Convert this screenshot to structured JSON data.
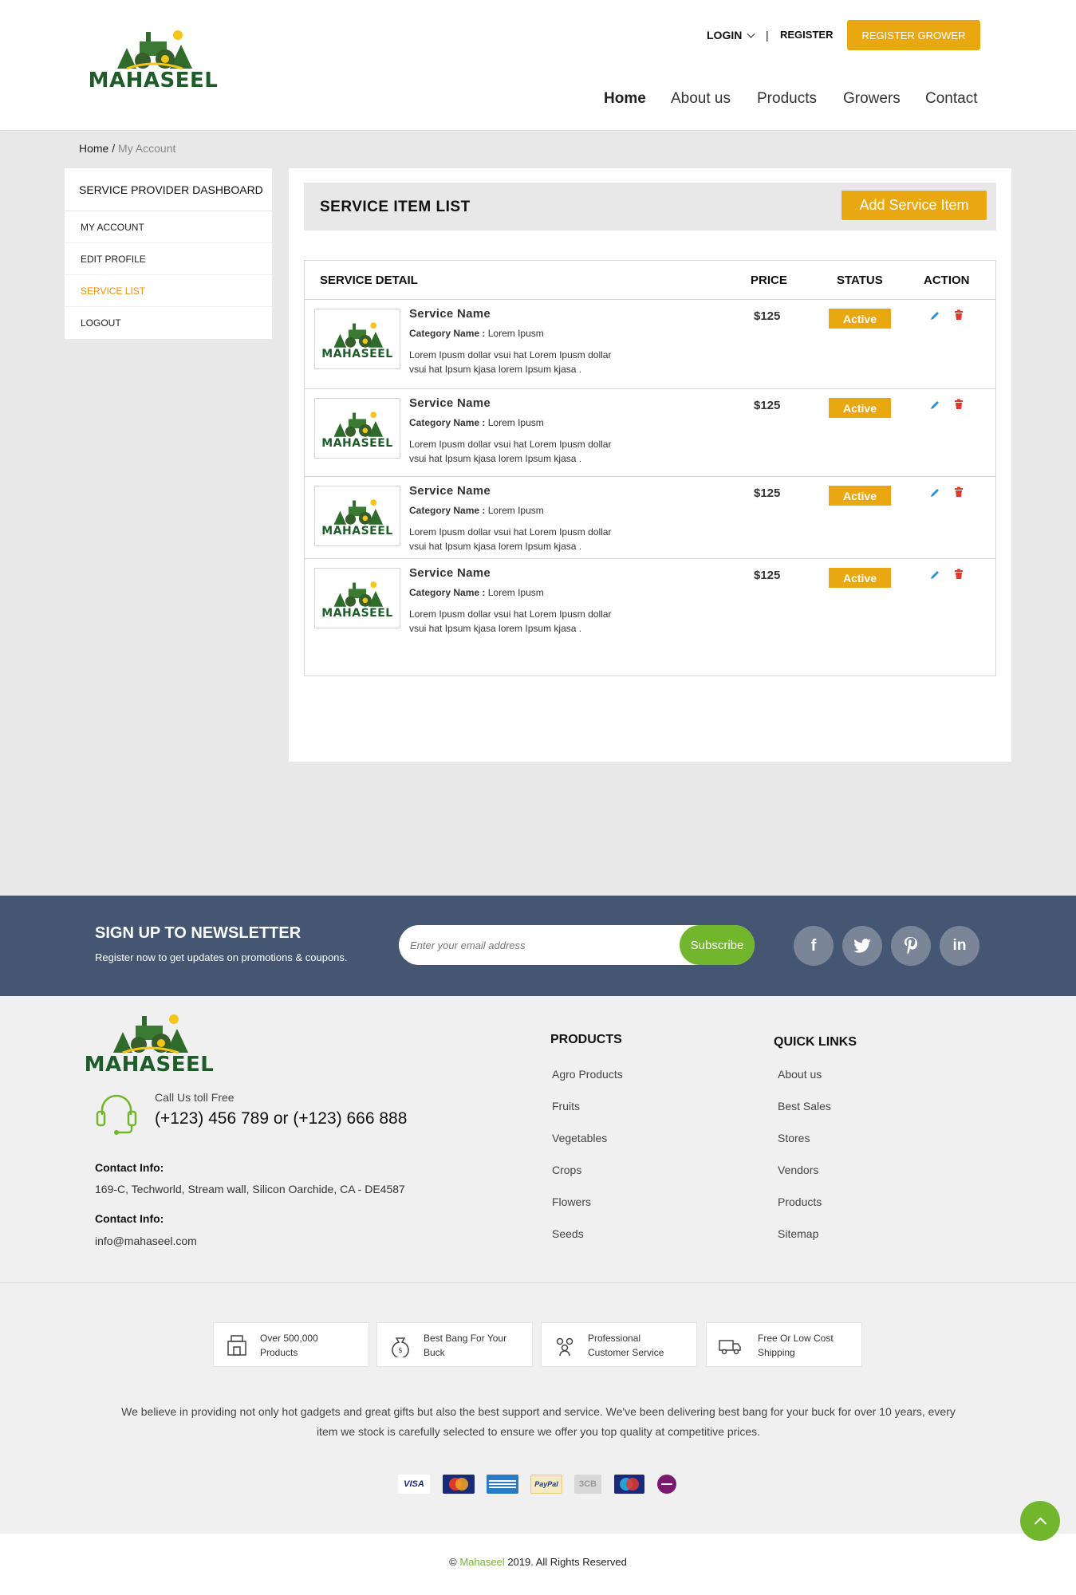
{
  "brand": {
    "name": "MAHASEEL"
  },
  "header": {
    "login_label": "LOGIN",
    "separator": "|",
    "register_label": "REGISTER",
    "register_grower_label": "REGISTER GROWER",
    "nav": [
      {
        "label": "Home"
      },
      {
        "label": "About us"
      },
      {
        "label": "Products"
      },
      {
        "label": "Growers"
      },
      {
        "label": "Contact"
      }
    ]
  },
  "breadcrumb": {
    "home": "Home",
    "separator": "/",
    "current": "My Account"
  },
  "sidebar": {
    "title": "SERVICE PROVIDER DASHBOARD",
    "items": [
      {
        "label": "MY ACCOUNT"
      },
      {
        "label": "EDIT PROFILE"
      },
      {
        "label": "SERVICE LIST"
      },
      {
        "label": "LOGOUT"
      }
    ],
    "active_color": "#e9900f"
  },
  "service_list": {
    "title": "SERVICE ITEM LIST",
    "add_button": "Add Service Item",
    "columns": {
      "detail": "SERVICE DETAIL",
      "price": "PRICE",
      "status": "STATUS",
      "action": "ACTION"
    },
    "rows": [
      {
        "name": "Service Name",
        "category_label": "Category Name :",
        "category_value": "Lorem Ipusm",
        "desc_line1": "Lorem Ipusm dollar vsui hat Lorem Ipusm dollar",
        "desc_line2": "vsui hat Ipsum kjasa lorem Ipsum kjasa .",
        "price": "$125",
        "status": "Active"
      },
      {
        "name": "Service Name",
        "category_label": "Category Name :",
        "category_value": "Lorem Ipusm",
        "desc_line1": "Lorem Ipusm dollar vsui hat Lorem Ipusm dollar",
        "desc_line2": "vsui hat Ipsum kjasa lorem Ipsum kjasa .",
        "price": "$125",
        "status": "Active"
      },
      {
        "name": "Service Name",
        "category_label": "Category Name :",
        "category_value": "Lorem Ipusm",
        "desc_line1": "Lorem Ipusm dollar vsui hat Lorem Ipusm dollar",
        "desc_line2": "vsui hat Ipsum kjasa lorem Ipsum kjasa .",
        "price": "$125",
        "status": "Active"
      },
      {
        "name": "Service Name",
        "category_label": "Category Name :",
        "category_value": "Lorem Ipusm",
        "desc_line1": "Lorem Ipusm dollar vsui hat Lorem Ipusm dollar",
        "desc_line2": "vsui hat Ipsum kjasa lorem Ipsum kjasa .",
        "price": "$125",
        "status": "Active"
      }
    ]
  },
  "newsletter": {
    "title": "SIGN UP TO NEWSLETTER",
    "subtitle": "Register now to get updates on promotions & coupons.",
    "placeholder": "Enter your email address",
    "button": "Subscribe",
    "social": [
      {
        "icon": "facebook-icon",
        "glyph": "f"
      },
      {
        "icon": "twitter-icon",
        "glyph": "t"
      },
      {
        "icon": "pinterest-icon",
        "glyph": "p"
      },
      {
        "icon": "linkedin-icon",
        "glyph": "in"
      }
    ]
  },
  "footer": {
    "call_label": "Call Us toll Free",
    "call_number": "(+123) 456 789 or (+123) 666 888",
    "contact_title_1": "Contact Info:",
    "address": "169-C, Techworld, Stream wall, Silicon Oarchide, CA - DE4587",
    "contact_title_2": "Contact Info:",
    "email": "info@mahaseel.com",
    "products_title": "PRODUCTS",
    "products": [
      "Agro Products",
      "Fruits",
      "Vegetables",
      "Crops",
      "Flowers",
      "Seeds"
    ],
    "quick_links_title": "QUICK LINKS",
    "quick_links": [
      "About us",
      "Best Sales",
      "Stores",
      "Vendors",
      "Products",
      "Sitemap"
    ],
    "features": [
      {
        "line1": "Over 500,000",
        "line2": "Products",
        "icon": "store-icon"
      },
      {
        "line1": "Best Bang For Your",
        "line2": "Buck",
        "icon": "money-bag-icon"
      },
      {
        "line1": "Professional",
        "line2": "Customer Service",
        "icon": "people-icon"
      },
      {
        "line1": "Free Or Low Cost",
        "line2": "Shipping",
        "icon": "truck-icon"
      }
    ],
    "about_line1": "We believe in providing not only hot gadgets and great gifts but also the best support and service. We've been delivering best bang for your buck for over 10 years, every",
    "about_line2": "item we stock is carefully selected to ensure we offer you top quality at competitive prices.",
    "payments": [
      {
        "label": "VISA"
      },
      {
        "label": "MasterCard"
      },
      {
        "label": "AMERICAN EXPRESS"
      },
      {
        "label": "PayPal"
      },
      {
        "label": "3CB"
      },
      {
        "label": "Maestro"
      },
      {
        "label": "Smart"
      }
    ],
    "copyright_prefix": "©",
    "copyright_brand": "Mahaseel",
    "copyright_suffix": "2019. All Rights Reserved"
  },
  "colors": {
    "accent": "#e9a712",
    "green": "#72b62e",
    "newsletter_bg": "#455673",
    "delete": "#e0392b",
    "edit": "#2a8fd6"
  }
}
